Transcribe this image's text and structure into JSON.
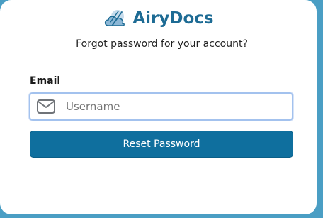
{
  "brand": {
    "logo_icon": "cloud-logo-icon",
    "name": "AiryDocs"
  },
  "form": {
    "subtitle": "Forgot password for your account?",
    "email_label": "Email",
    "email_icon": "envelope-icon",
    "email_placeholder": "Username",
    "email_value": "",
    "submit_label": "Reset Password"
  },
  "colors": {
    "page_background": "#4a9ec4",
    "brand_text": "#1d6b94",
    "button_background": "#0f6f9e",
    "input_focus_border": "#a3c2ee"
  }
}
